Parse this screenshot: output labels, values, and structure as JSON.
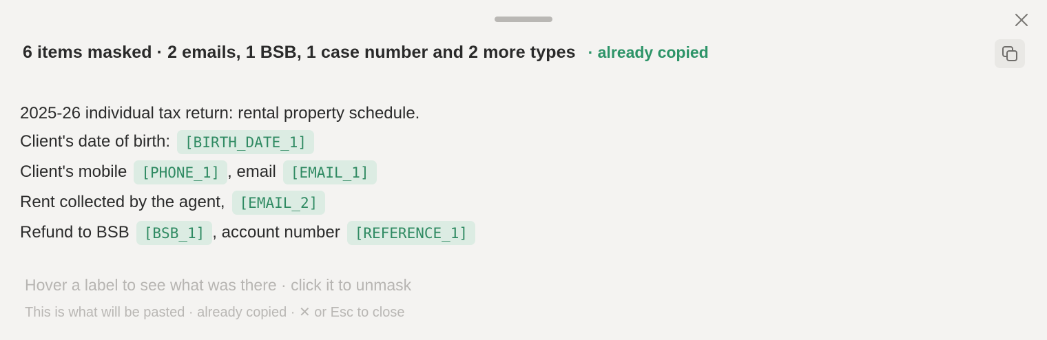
{
  "header": {
    "title": "6 items masked · 2 emails, 1 BSB, 1 case number and 2 more types",
    "status": "· already copied"
  },
  "icons": {
    "close": "close-icon",
    "copy": "copy-icon",
    "drag": "drag-handle"
  },
  "preview": {
    "line1": {
      "text": "2025-26 individual tax return: rental property schedule."
    },
    "line2": {
      "text": "Client's date of birth:",
      "token": "[BIRTH_DATE_1]"
    },
    "line3": {
      "text_a": "Client's mobile",
      "token_a": "[PHONE_1]",
      "text_b": ", email",
      "token_b": "[EMAIL_1]"
    },
    "line4": {
      "text": "Rent collected by the agent,",
      "token": "[EMAIL_2]"
    },
    "line5": {
      "text_a": "Refund to BSB",
      "token_a": "[BSB_1]",
      "text_b": ", account number",
      "token_b": "[REFERENCE_1]"
    }
  },
  "hint": "Hover a label to see what was there · click it to unmask",
  "footer": "This is what will be pasted · already copied · ✕ or Esc to close",
  "colors": {
    "accent": "#2d9468",
    "token_bg": "#dcece3",
    "token_text": "#2f8a62",
    "panel_bg": "#f4f3f1"
  }
}
